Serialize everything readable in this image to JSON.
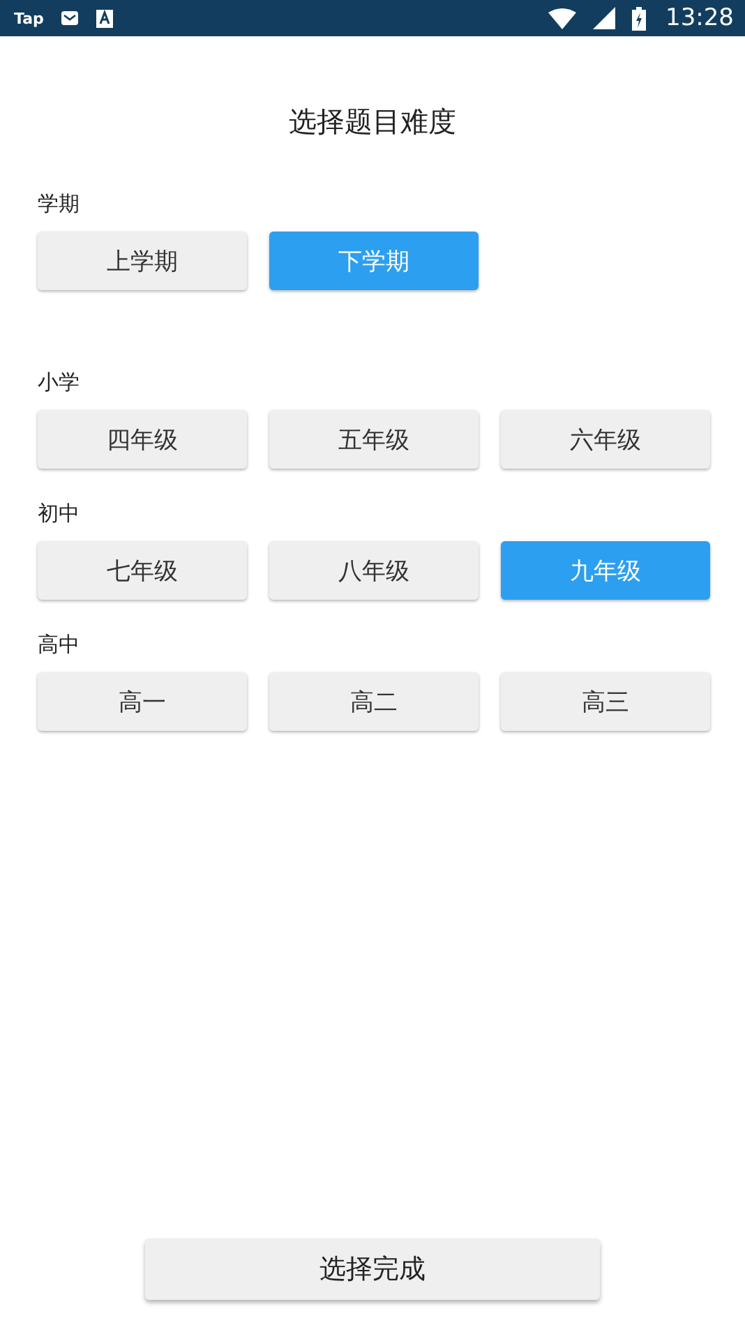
{
  "status_bar": {
    "app_label": "Tap",
    "time": "13:28"
  },
  "title": "选择题目难度",
  "sections": [
    {
      "label": "学期",
      "options": [
        {
          "label": "上学期",
          "selected": false
        },
        {
          "label": "下学期",
          "selected": true
        }
      ]
    },
    {
      "label": "小学",
      "options": [
        {
          "label": "四年级",
          "selected": false
        },
        {
          "label": "五年级",
          "selected": false
        },
        {
          "label": "六年级",
          "selected": false
        }
      ]
    },
    {
      "label": "初中",
      "options": [
        {
          "label": "七年级",
          "selected": false
        },
        {
          "label": "八年级",
          "selected": false
        },
        {
          "label": "九年级",
          "selected": true
        }
      ]
    },
    {
      "label": "高中",
      "options": [
        {
          "label": "高一",
          "selected": false
        },
        {
          "label": "高二",
          "selected": false
        },
        {
          "label": "高三",
          "selected": false
        }
      ]
    }
  ],
  "done_button": "选择完成"
}
